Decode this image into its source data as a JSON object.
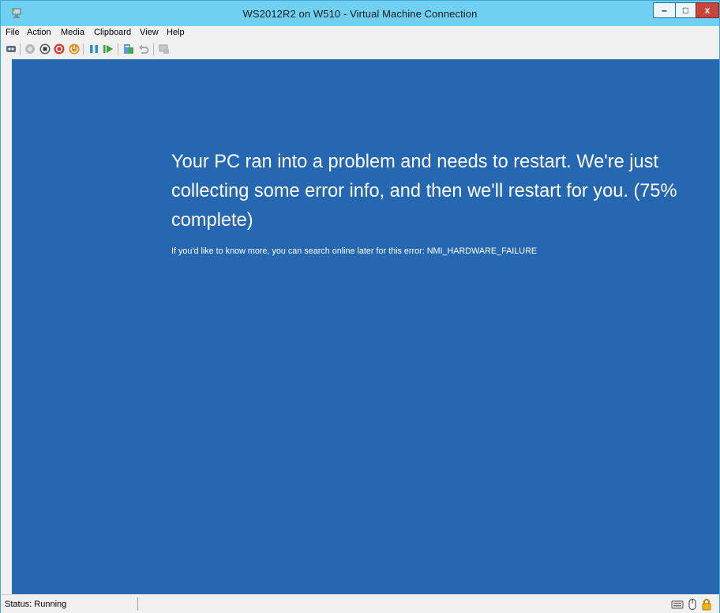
{
  "window": {
    "title": "WS2012R2 on W510 - Virtual Machine Connection",
    "controls": {
      "minimize": "–",
      "maximize": "□",
      "close": "x"
    }
  },
  "menu": [
    "File",
    "Action",
    "Media",
    "Clipboard",
    "View",
    "Help"
  ],
  "toolbar": [
    {
      "icon": "ctrl-alt-del-icon"
    },
    {
      "icon": "start-icon"
    },
    {
      "icon": "turn-off-icon"
    },
    {
      "icon": "shut-down-icon"
    },
    {
      "icon": "save-icon"
    },
    {
      "icon": "pause-icon"
    },
    {
      "icon": "resume-icon"
    },
    {
      "icon": "checkpoint-icon"
    },
    {
      "icon": "revert-icon"
    },
    {
      "icon": "enhanced-session-icon"
    }
  ],
  "screen": {
    "message": "Your PC ran into a problem and needs to restart. We're just collecting some error info, and then we'll restart for you. (75% complete)",
    "detail": "If you'd like to know more, you can search online later for this error: NMI_HARDWARE_FAILURE",
    "background_color": "#2567b0"
  },
  "status": {
    "text": "Status: Running",
    "icons": [
      "keyboard-icon",
      "mouse-icon",
      "lock-icon"
    ]
  }
}
